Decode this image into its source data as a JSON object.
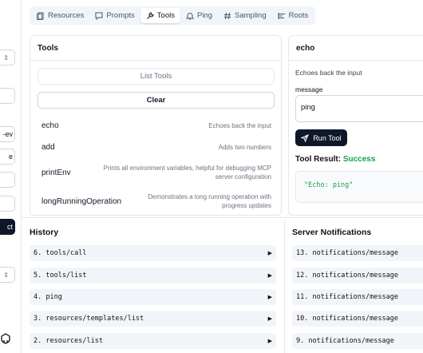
{
  "sidebar": {
    "select1_chevron": "⇕",
    "field1": "",
    "field2": "-ev",
    "field3": "e",
    "field4": "",
    "field5": "",
    "connect_label": "ct",
    "select2_chevron": "⇕",
    "github_icon": "github-icon"
  },
  "tabs": [
    {
      "label": "Resources",
      "icon": "resources-icon"
    },
    {
      "label": "Prompts",
      "icon": "prompts-icon"
    },
    {
      "label": "Tools",
      "icon": "wrench-icon",
      "active": true
    },
    {
      "label": "Ping",
      "icon": "bell-icon"
    },
    {
      "label": "Sampling",
      "icon": "hash-icon"
    },
    {
      "label": "Roots",
      "icon": "roots-icon"
    }
  ],
  "tools": {
    "title": "Tools",
    "list_button": "List Tools",
    "clear_button": "Clear",
    "items": [
      {
        "name": "echo",
        "description": "Echoes back the input"
      },
      {
        "name": "add",
        "description": "Adds two numbers"
      },
      {
        "name": "printEnv",
        "description": "Prints all environment variables, helpful for debugging MCP server configuration"
      },
      {
        "name": "longRunningOperation",
        "description": "Demonstrates a long running operation with progress updates"
      }
    ]
  },
  "echo": {
    "title": "echo",
    "description": "Echoes back the input",
    "message_label": "message",
    "message_value": "ping",
    "run_button": "Run Tool",
    "result_label": "Tool Result:",
    "result_status": "Success",
    "result_text": "\"Echo: ping\""
  },
  "history": {
    "title": "History",
    "items": [
      "6. tools/call",
      "5. tools/list",
      "4. ping",
      "3. resources/templates/list",
      "2. resources/list"
    ]
  },
  "notifications": {
    "title": "Server Notifications",
    "items": [
      "13. notifications/message",
      "12. notifications/message",
      "11. notifications/message",
      "10. notifications/message",
      "9. notifications/message"
    ]
  },
  "colors": {
    "primary": "#0f172a",
    "success": "#16a34a",
    "muted": "#6b7280",
    "row_bg": "#f1f5f9"
  }
}
